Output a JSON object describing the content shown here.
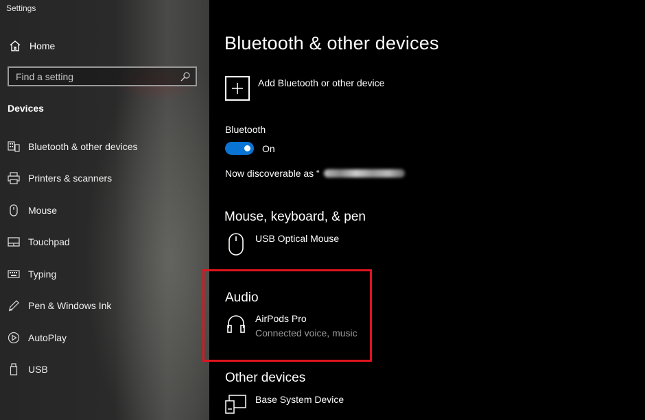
{
  "window": {
    "title": "Settings"
  },
  "sidebar": {
    "home_label": "Home",
    "search_placeholder": "Find a setting",
    "section": "Devices",
    "items": [
      {
        "label": "Bluetooth & other devices",
        "icon": "bluetooth-devices-icon"
      },
      {
        "label": "Printers & scanners",
        "icon": "printer-icon"
      },
      {
        "label": "Mouse",
        "icon": "mouse-icon"
      },
      {
        "label": "Touchpad",
        "icon": "touchpad-icon"
      },
      {
        "label": "Typing",
        "icon": "keyboard-icon"
      },
      {
        "label": "Pen & Windows Ink",
        "icon": "pen-icon"
      },
      {
        "label": "AutoPlay",
        "icon": "autoplay-icon"
      },
      {
        "label": "USB",
        "icon": "usb-icon"
      }
    ]
  },
  "main": {
    "title": "Bluetooth & other devices",
    "add_label": "Add Bluetooth or other device",
    "bluetooth_label": "Bluetooth",
    "bluetooth_state": "On",
    "discoverable_prefix": "Now discoverable as “",
    "sections": {
      "mouse_keyboard": {
        "heading": "Mouse, keyboard, & pen",
        "device": {
          "name": "USB Optical Mouse",
          "icon": "mouse-icon"
        }
      },
      "audio": {
        "heading": "Audio",
        "device": {
          "name": "AirPods Pro",
          "status": "Connected voice, music",
          "icon": "headphones-icon"
        }
      },
      "other": {
        "heading": "Other devices",
        "device": {
          "name": "Base System Device",
          "icon": "system-device-icon"
        }
      }
    }
  },
  "colors": {
    "accent": "#0a74d4",
    "highlight": "#e0141e",
    "secondary_text": "#9a9a9a"
  }
}
